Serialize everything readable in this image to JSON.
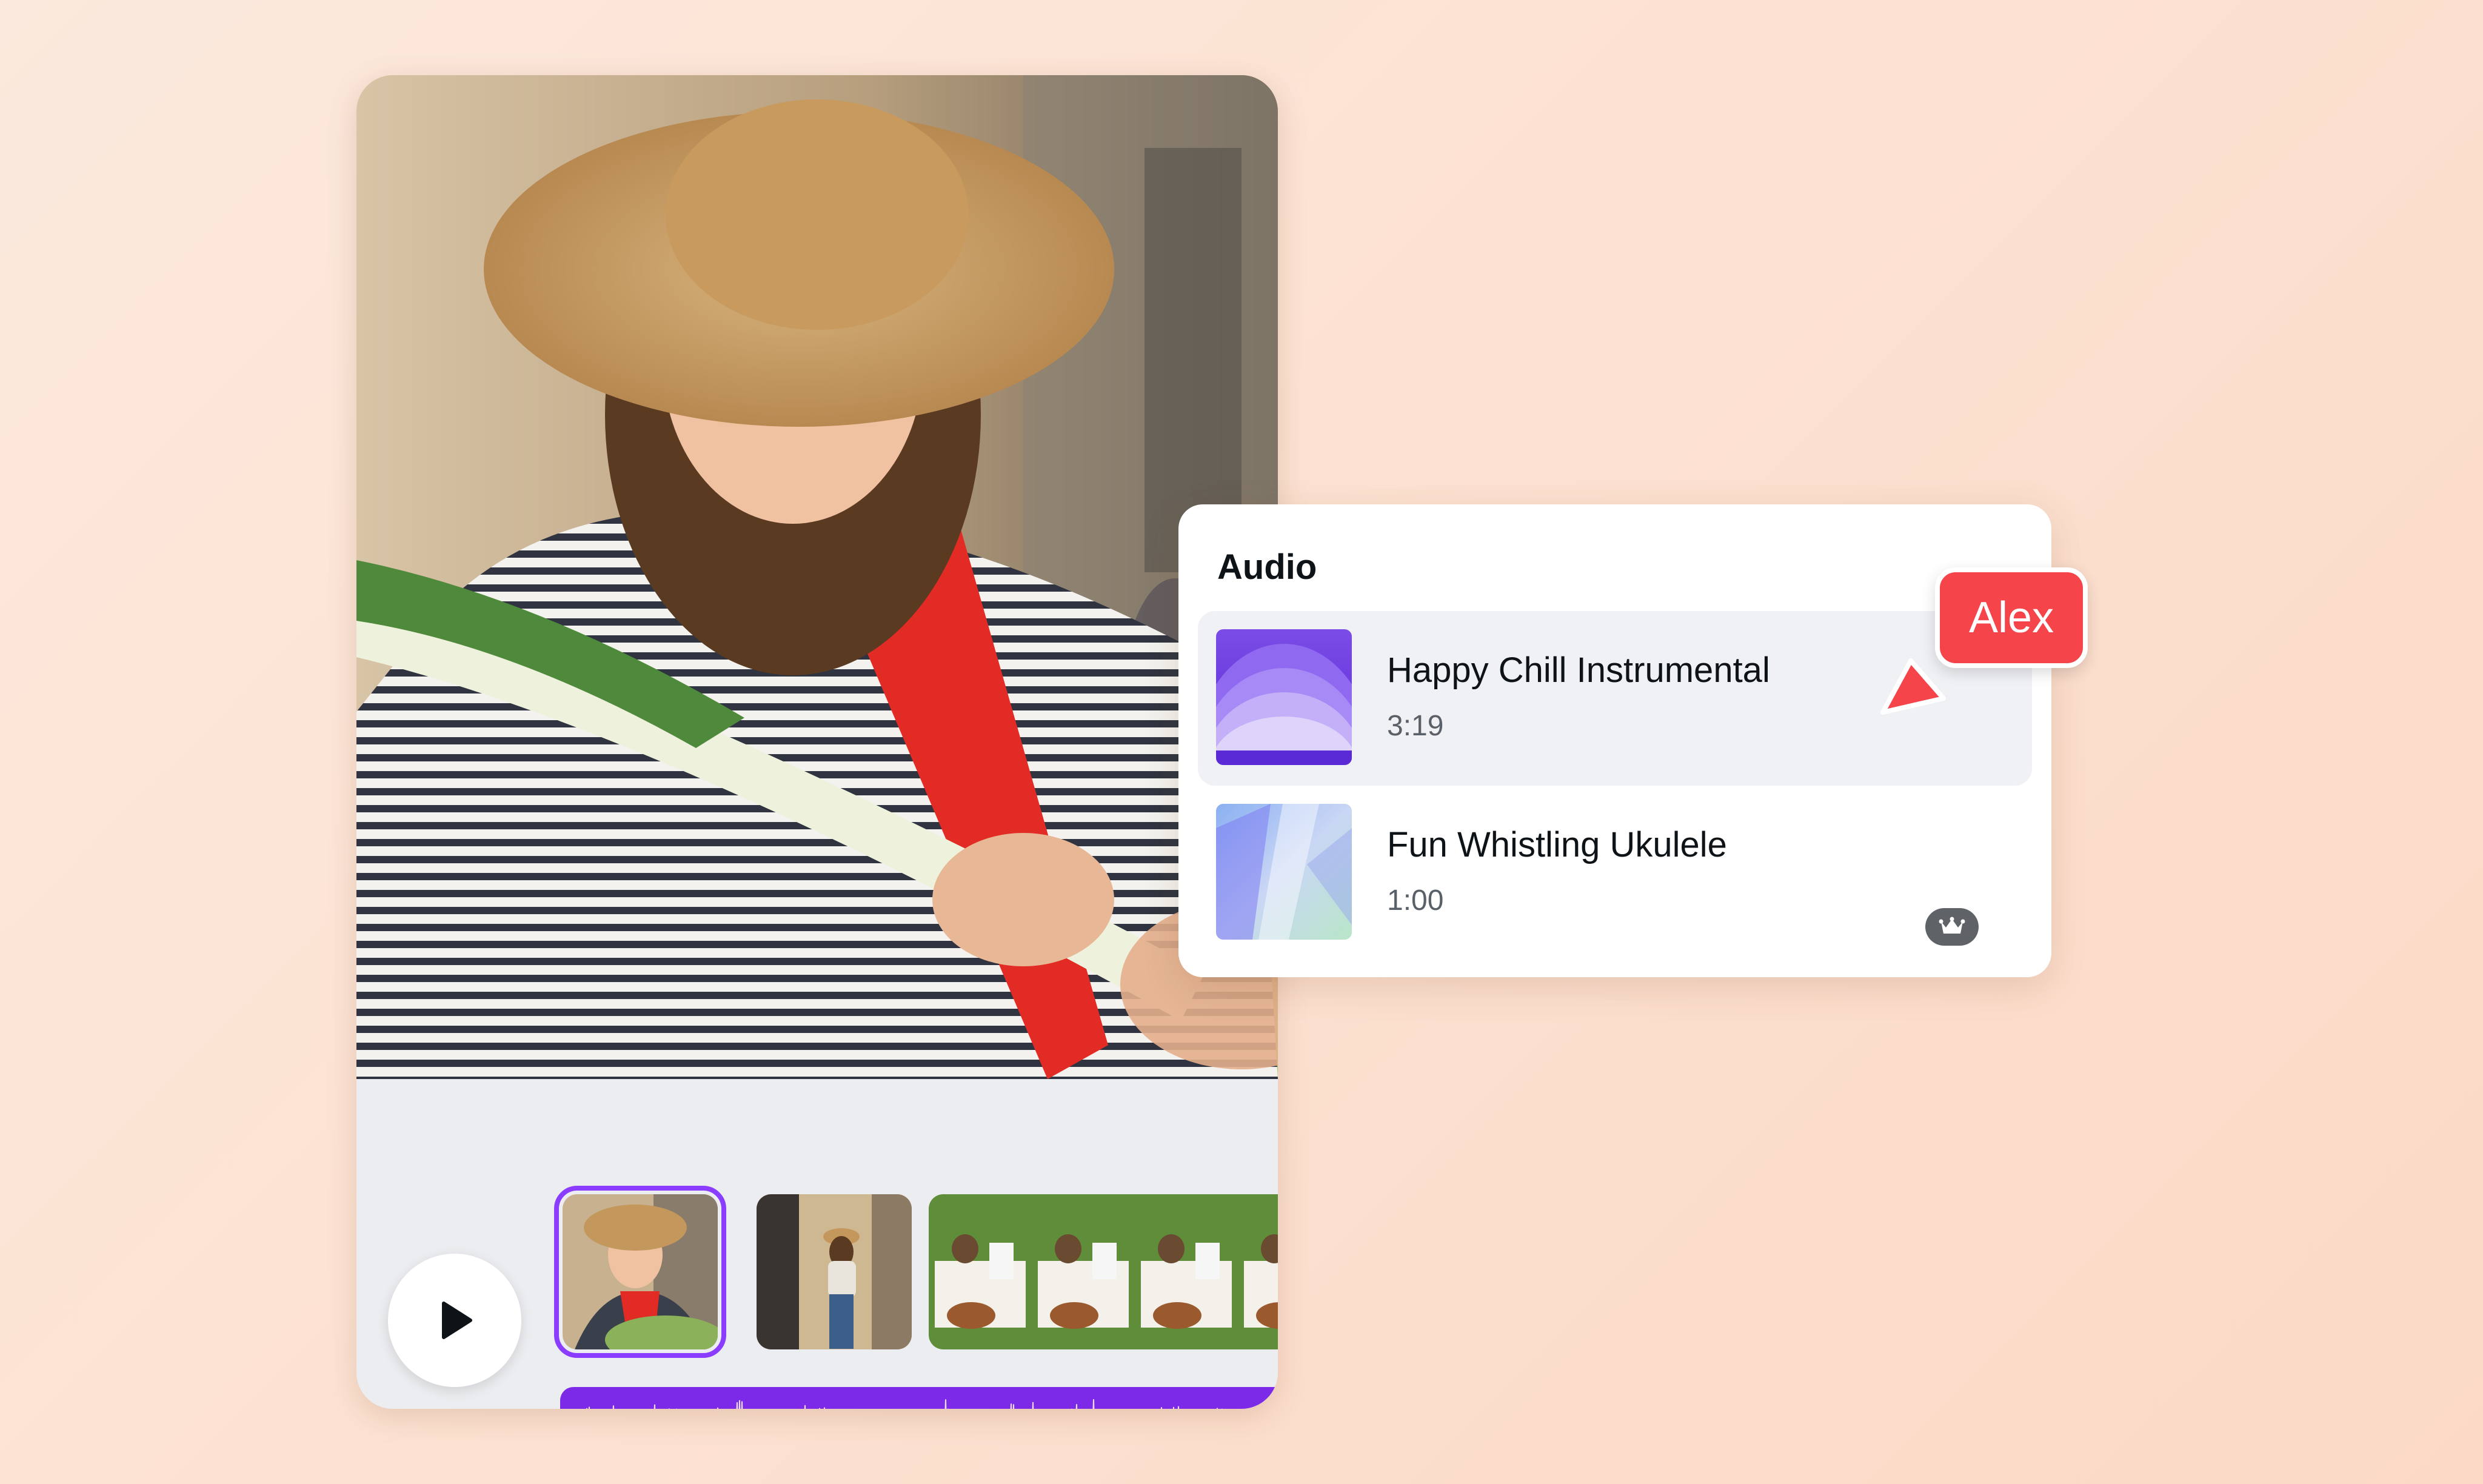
{
  "audio_panel": {
    "title": "Audio",
    "tracks": [
      {
        "title": "Happy Chill Instrumental",
        "duration": "3:19",
        "selected": true,
        "premium": false
      },
      {
        "title": "Fun Whistling Ukulele",
        "duration": "1:00",
        "selected": false,
        "premium": true
      }
    ]
  },
  "collaborator": {
    "name": "Alex",
    "color": "#f6444b"
  },
  "timeline": {
    "clips": [
      "market-vendor-clip",
      "woman-walking-street-clip",
      "picnic-group-clip"
    ],
    "selected_clip": 0,
    "accent_color": "#8b3dff",
    "audio_track_color": "#7d2ae8"
  },
  "icons": {
    "play": "play-icon",
    "premium": "crown-icon",
    "cursor": "cursor-icon"
  }
}
